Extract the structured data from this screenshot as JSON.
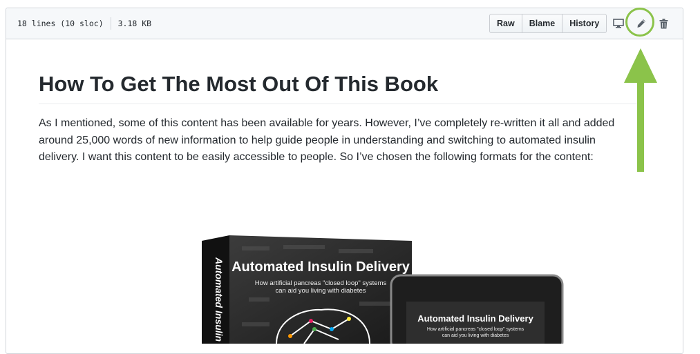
{
  "file_info": {
    "lines": "18 lines (10 sloc)",
    "size": "3.18 KB"
  },
  "toolbar": {
    "raw_label": "Raw",
    "blame_label": "Blame",
    "history_label": "History",
    "icons": [
      "desktop-icon",
      "pencil-icon",
      "trash-icon"
    ]
  },
  "article": {
    "title": "How To Get The Most Out Of This Book",
    "intro": "As I mentioned, some of this content has been available for years. However, I’ve completely re-written it all and added around 25,000 words of new information to help guide people in understanding and switching to automated insulin delivery. I want this content to be easily accessible to people. So I’ve chosen the following formats for the content:"
  },
  "book_image": {
    "spine_text": "Automated Insulin De",
    "cover_title": "Automated Insulin Delivery",
    "cover_subtitle_1": "How artificial pancreas \"closed loop\" systems",
    "cover_subtitle_2": "can aid you living with diabetes",
    "tablet_title": "Automated Insulin Delivery",
    "tablet_subtitle_1": "How artificial pancreas \"closed loop\" systems",
    "tablet_subtitle_2": "can aid you living with diabetes"
  },
  "colors": {
    "annotation": "#8bc34a",
    "text": "#24292e",
    "header_bg": "#f6f8fa"
  }
}
